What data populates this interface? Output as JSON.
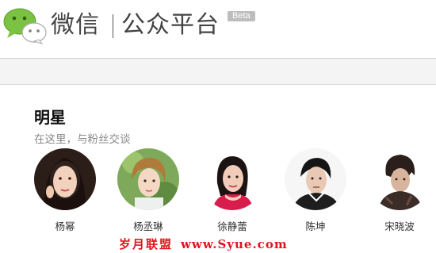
{
  "header": {
    "logo_icon": "wechat-bubbles-icon",
    "brand_name": "微信",
    "platform_name": "公众平台",
    "badge": "Beta"
  },
  "section": {
    "title": "明星",
    "subtitle": "在这里，与粉丝交谈",
    "stars": [
      {
        "name": "杨幂"
      },
      {
        "name": "杨丞琳"
      },
      {
        "name": "徐静蕾"
      },
      {
        "name": "陈坤"
      },
      {
        "name": "宋晓波"
      }
    ]
  },
  "watermark": {
    "text": "岁月联盟",
    "url": "www.Syue.com"
  },
  "colors": {
    "logo_green": "#7cc242",
    "badge_gray": "#bdbdbd",
    "watermark_red": "#e0141e"
  }
}
